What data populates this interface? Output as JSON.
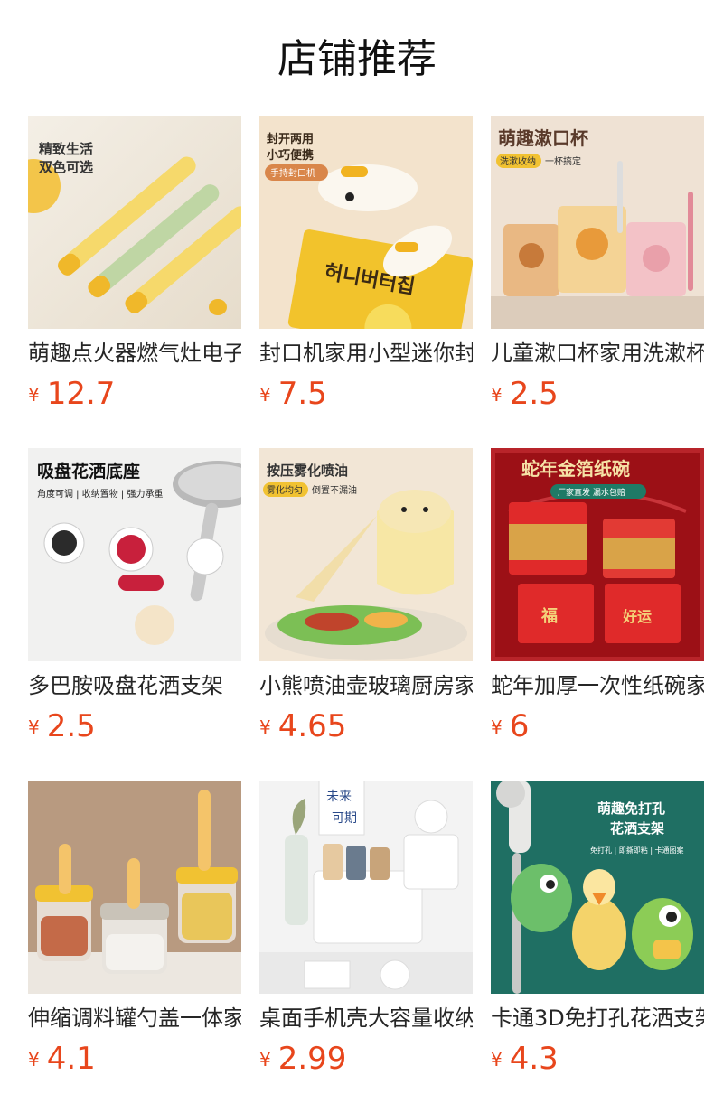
{
  "section": {
    "title": "店铺推荐"
  },
  "currency_symbol": "¥",
  "products": [
    {
      "name": "萌趣点火器燃气灶电子",
      "price": "12.7",
      "image_text": [
        "精致生活",
        "双色可选"
      ]
    },
    {
      "name": "封口机家用小型迷你封",
      "price": "7.5",
      "image_text": [
        "封开两用",
        "小巧便携",
        "手持封口机",
        "허니버터칩"
      ]
    },
    {
      "name": "儿童漱口杯家用洗漱杯",
      "price": "2.5",
      "image_text": [
        "萌趣漱口杯",
        "洗漱收纳",
        "一杯搞定"
      ]
    },
    {
      "name": "多巴胺吸盘花洒支架",
      "price": "2.5",
      "image_text": [
        "吸盘花洒底座",
        "角度可调 | 收纳置物 | 强力承重"
      ]
    },
    {
      "name": "小熊喷油壶玻璃厨房家",
      "price": "4.65",
      "image_text": [
        "按压雾化喷油",
        "雾化均匀",
        "倒置不漏油"
      ]
    },
    {
      "name": "蛇年加厚一次性纸碗家",
      "price": "6",
      "image_text": [
        "蛇年金箔纸碗",
        "厂家直发 漏水包赔",
        "福",
        "好运"
      ]
    },
    {
      "name": "伸缩调料罐勺盖一体家",
      "price": "4.1",
      "image_text": []
    },
    {
      "name": "桌面手机壳大容量收纳",
      "price": "2.99",
      "image_text": [
        "未来",
        "可期"
      ]
    },
    {
      "name": "卡通3D免打孔花洒支架",
      "price": "4.3",
      "image_text": [
        "萌趣免打孔",
        "花洒支架",
        "免打孔 | 即撕即粘 | 卡通图案"
      ]
    }
  ]
}
